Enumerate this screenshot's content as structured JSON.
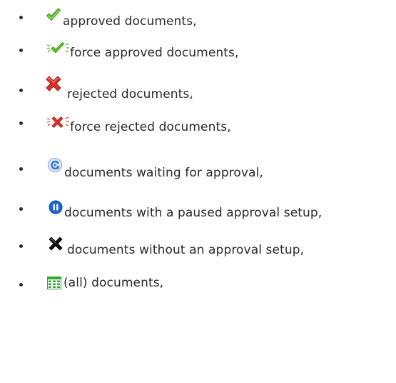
{
  "items": [
    {
      "icon": "green-check-icon",
      "text": "approved documents,"
    },
    {
      "icon": "force-approved-check-icon",
      "text": "force approved documents,"
    },
    {
      "icon": "red-x-icon",
      "text": "rejected documents,"
    },
    {
      "icon": "force-rejected-x-icon",
      "text": "force rejected documents,"
    },
    {
      "icon": "waiting-approval-icon",
      "text": "documents waiting for approval,"
    },
    {
      "icon": "paused-icon",
      "text": "documents with a paused approval setup,"
    },
    {
      "icon": "black-x-icon",
      "text": "documents without an approval setup,"
    },
    {
      "icon": "spreadsheet-icon",
      "text": "(all) documents,"
    }
  ],
  "colors": {
    "check_green": "#5cbf2a",
    "reject_red": "#d8322a",
    "waiting_blue": "#2f78d8",
    "paused_blue": "#1a66cc",
    "grid_green": "#2ea836",
    "text": "#2b2b2b"
  }
}
